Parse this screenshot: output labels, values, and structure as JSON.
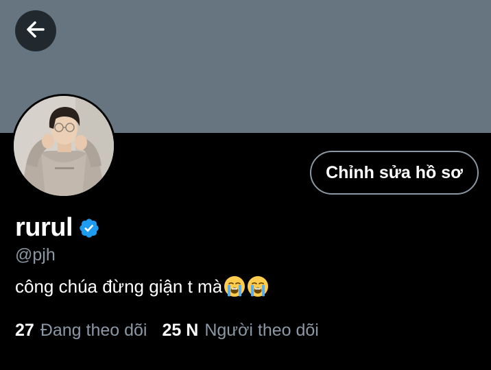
{
  "header": {
    "back_icon": "arrow-left-icon"
  },
  "profile": {
    "display_name": "rurul",
    "verified_icon": "verified-badge-icon",
    "handle": "@pjh",
    "bio": "công chúa đừng giận t mà",
    "bio_emoji": [
      "loudly-crying-face-icon",
      "loudly-crying-face-icon"
    ],
    "edit_button_label": "Chỉnh sửa hồ sơ"
  },
  "stats": {
    "following_count": "27",
    "following_label": "Đang theo dõi",
    "followers_count": "25 N",
    "followers_label": "Người theo dõi"
  },
  "colors": {
    "banner": "#66757f",
    "background": "#000000",
    "verified": "#1d9bf0",
    "secondary_text": "#8b98a5"
  }
}
